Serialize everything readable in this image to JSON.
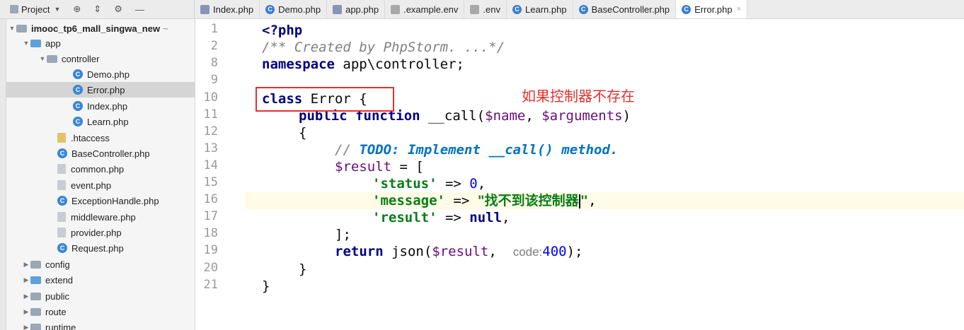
{
  "project": {
    "label": "Project",
    "dropdown": "▼"
  },
  "tabs": [
    {
      "label": "Index.php",
      "icon": "php"
    },
    {
      "label": "Demo.php",
      "icon": "c"
    },
    {
      "label": "app.php",
      "icon": "php"
    },
    {
      "label": ".example.env",
      "icon": "env"
    },
    {
      "label": ".env",
      "icon": "env"
    },
    {
      "label": "Learn.php",
      "icon": "c"
    },
    {
      "label": "BaseController.php",
      "icon": "c"
    },
    {
      "label": "Error.php",
      "icon": "c",
      "active": true
    }
  ],
  "tree": [
    {
      "label": "imooc_tp6_mall_singwa_new",
      "path_hint": "~",
      "type": "root"
    },
    {
      "label": "app",
      "type": "folder"
    },
    {
      "label": "controller",
      "type": "folder"
    },
    {
      "label": "Demo.php",
      "type": "class"
    },
    {
      "label": "Error.php",
      "type": "class",
      "selected": true
    },
    {
      "label": "Index.php",
      "type": "class"
    },
    {
      "label": "Learn.php",
      "type": "class"
    },
    {
      "label": ".htaccess",
      "type": "file"
    },
    {
      "label": "BaseController.php",
      "type": "class"
    },
    {
      "label": "common.php",
      "type": "file"
    },
    {
      "label": "event.php",
      "type": "file"
    },
    {
      "label": "ExceptionHandle.php",
      "type": "class"
    },
    {
      "label": "middleware.php",
      "type": "file"
    },
    {
      "label": "provider.php",
      "type": "file"
    },
    {
      "label": "Request.php",
      "type": "class"
    },
    {
      "label": "config",
      "type": "folder"
    },
    {
      "label": "extend",
      "type": "folder"
    },
    {
      "label": "public",
      "type": "folder"
    },
    {
      "label": "route",
      "type": "folder"
    },
    {
      "label": "runtime",
      "type": "folder"
    }
  ],
  "line_numbers": [
    "1",
    "2",
    "8",
    "9",
    "10",
    "11",
    "12",
    "13",
    "14",
    "15",
    "16",
    "17",
    "18",
    "19",
    "20",
    "21"
  ],
  "code": {
    "l1": "<?php",
    "l2": "/** Created by PhpStorm. ...*/",
    "l8_kw": "namespace",
    "l8_rest": " app\\controller;",
    "l10_kw": "class",
    "l10_rest": " Error {",
    "l11_kw1": "public",
    "l11_kw2": "function",
    "l11_name": " __call(",
    "l11_v1": "$name",
    "l11_sep": ", ",
    "l11_v2": "$arguments",
    "l11_end": ")",
    "l12": "{",
    "l13_cmt": "// ",
    "l13_todo": "TODO: Implement __call() method.",
    "l14_var": "$result",
    "l14_rest": " = [",
    "l15_key": "'status'",
    "l15_arrow": " => ",
    "l15_val": "0",
    "l15_end": ",",
    "l16_key": "'message'",
    "l16_arrow": " => ",
    "l16_val": "\"找不到该控制器",
    "l16_val2": "\"",
    "l16_end": ",",
    "l17_key": "'result'",
    "l17_arrow": " => ",
    "l17_val": "null",
    "l17_end": ",",
    "l18": "];",
    "l19_kw": "return",
    "l19_fn": " json(",
    "l19_var": "$result",
    "l19_sep": ",  ",
    "l19_hint": "code:",
    "l19_num": "400",
    "l19_end": ");",
    "l20": "}",
    "l21": "}"
  },
  "annotation": "如果控制器不存在",
  "colors": {
    "annotation": "#e53030",
    "keyword": "#000080",
    "string": "#067d17"
  }
}
